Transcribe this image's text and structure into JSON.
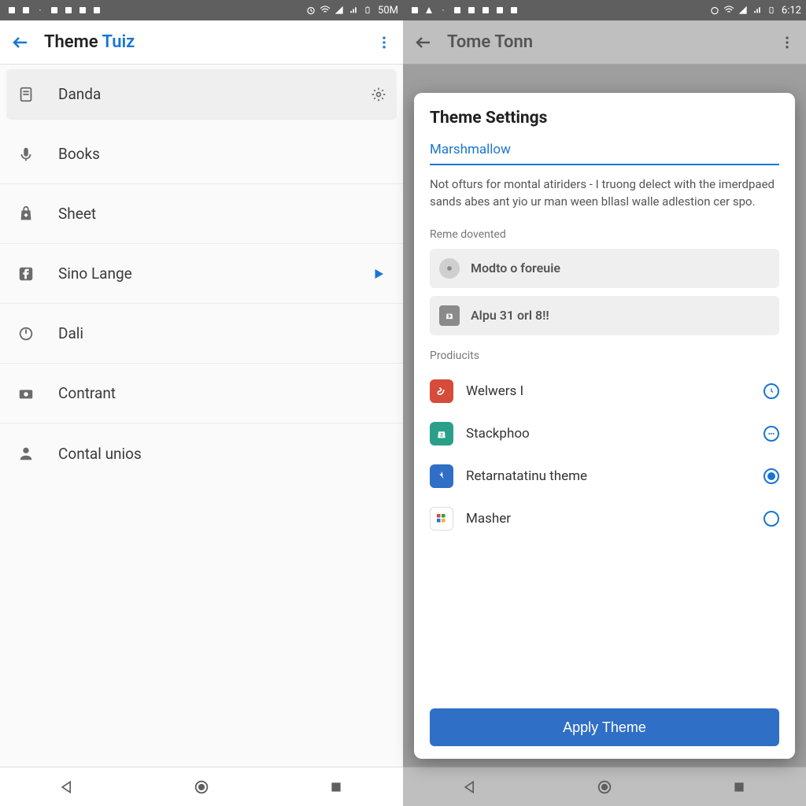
{
  "left": {
    "status": {
      "clock": "50M"
    },
    "appbar": {
      "title_main": "Theme ",
      "title_accent": "Tuiz"
    },
    "items": [
      {
        "label": "Danda"
      },
      {
        "label": "Books"
      },
      {
        "label": "Sheet"
      },
      {
        "label": "Sino Lange"
      },
      {
        "label": "Dali"
      },
      {
        "label": "Contrant"
      },
      {
        "label": "Contal unios"
      }
    ]
  },
  "right": {
    "status": {
      "clock": "6:12"
    },
    "appbar": {
      "title_main": "Tome ",
      "title_accent": "Tonn"
    },
    "sheet": {
      "title": "Theme Settings",
      "theme_name": "Marshmallow",
      "description": "Not ofturs for montal atiriders - I truong delect with the imerdpaed sands abes ant yio ur man ween bllasl walle adlestion cer spo.",
      "section1_label": "Reme dovented",
      "cards": [
        {
          "label": "Modto o foreuie"
        },
        {
          "label": "Alpu 31 orl 8!!"
        }
      ],
      "section2_label": "Prodiucits",
      "products": [
        {
          "label": "Welwers I",
          "color": "bg-red",
          "radio": "clock"
        },
        {
          "label": "Stackphoo",
          "color": "bg-teal",
          "radio": "dots"
        },
        {
          "label": "Retarnatatinu theme",
          "color": "bg-blue",
          "radio": "on"
        },
        {
          "label": "Masher",
          "color": "bg-white",
          "radio": "off"
        }
      ],
      "apply_label": "Apply Theme"
    }
  }
}
